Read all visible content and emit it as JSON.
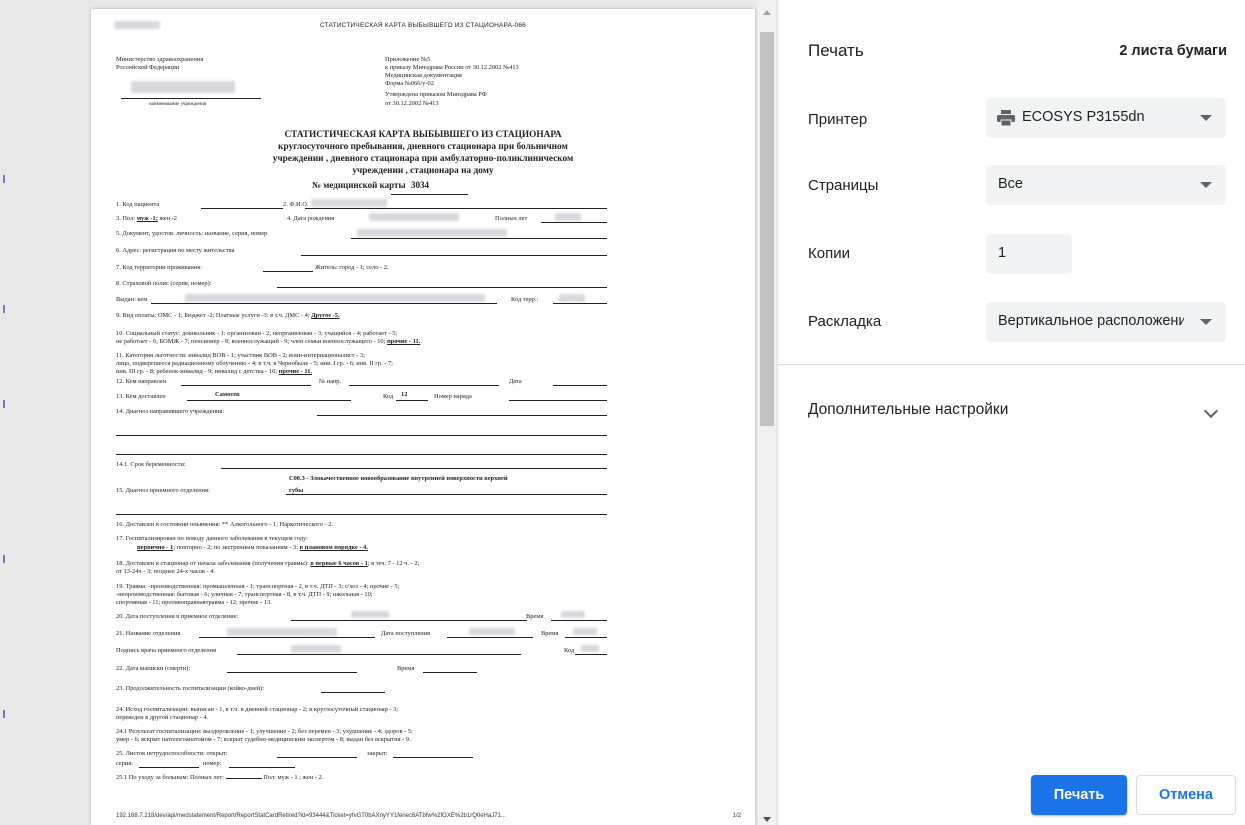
{
  "preview": {
    "header_title": "СТАТИСТИЧЕСКАЯ КАРТА ВЫБЫВШЕГО ИЗ СТАЦИОНАРА-066",
    "left_header_1": "Министерство здравоохранения",
    "left_header_2": "Российской Федерации",
    "institution_caption": "наименование учреждения",
    "right_header": [
      "Приложение №5",
      "к приказу Минздрава России от 30.12.2002 №413",
      "Медицинская документация",
      "Форма №066/у-02",
      "Утверждена приказом Минздрава РФ",
      "от 30.12.2002 №413"
    ],
    "title_lines": [
      "СТАТИСТИЧЕСКАЯ КАРТА ВЫБЫВШЕГО ИЗ СТАЦИОНАРА",
      "круглосуточного пребывания, дневного стационара при больничном",
      "учреждении , дневного стационара при амбулаторно-поликлиническом",
      "учреждении , стационара на дому"
    ],
    "card_no_label": "№ медицинской карты",
    "card_no": "3034",
    "fields": {
      "f1": "1. Код пациента",
      "f2": "2. Ф.И.О.",
      "f3a": "3. Пол:",
      "f3b": "муж -1;",
      "f3c": " жен -2",
      "f4": "4. Дата рождения",
      "f4b": "Полных лет",
      "f5": "5. Документ, удостов. личность: название, серия, номер",
      "f6": "6. Адрес: регистрация по месту жительства",
      "f7": "7. Код территории проживания:",
      "f7b": "Житель: город - 1; село - 2.",
      "f8": "8. Страховой полис (серия, номер):",
      "f8b": "Выдан: кем",
      "f8c": "Код терр.:",
      "f9a": "9. Вид оплаты: ОМС - 1; Бюджет -2; Платные услуги -3: в т.ч. ДМС - 4;",
      "f9b": "Другое -5.",
      "f10a": "10. Социальный статус: дошкольник - 1: организован - 2; неорганизован - 3; учащийся - 4; работает - 5;",
      "f10b": "не работает - 6; БОМЖ - 7; пенсионер - 8; военнослужащий - 9; член семьи военнослужащего - 10;",
      "f10c": "прочие - 11.",
      "f11a": "11. Категория льготности: инвалид ВОВ - 1; участник ВОВ - 2; воин-интернационалист - 3;",
      "f11b": "лицо, подвергшееся радиационному облучению - 4; в т.ч. в Чернобыле - 5; инв. I гр. - 6; инв. II гр. - 7;",
      "f11c": "инв. III гр. - 8; ребенок-инвалид - 9; инвалид с детства - 10;",
      "f11d": "прочие - 11.",
      "f12": "12. Кем направлен",
      "f12b": "№ напр.",
      "f12c": "Дата",
      "f13": "13. Кем доставлен",
      "f13v": "Самотек",
      "f13b": "Код",
      "f13bv": "12",
      "f13c": "Номер наряда",
      "f14": "14. Диагноз направившего учреждения:",
      "f141": "14.1. Срок беременности:",
      "f15v1": "C00.3 - Злокачественное новообразование внутренней поверхности верхней",
      "f15v2": "губы",
      "f15": "15. Диагноз приемного отделения:",
      "f16": "16. Доставлен в состоянии опьянения: ** Алкогольного - 1; Наркотического - 2.",
      "f17": "17. Госпитализирован по поводу данного заболевания в текущем году:",
      "f17b": "первично - 1",
      "f17c": "; повторно - 2; по экстренным показаниям - 3;",
      "f17d": "в плановом порядке - 4.",
      "f18a": "18. Доставлен в стационар от начала заболевания (получения травмы):",
      "f18b": "в первые 6 часов - 1",
      "f18c": "; в теч. 7 - 12 ч. - 2;",
      "f18d": "от 13-24ч - 3; позднее 24-х часов - 4.",
      "f19a": "19. Травма: -производственная: промышленная - 1; транспортная - 2, в т.ч. ДТП - 3; с/хоз - 4; прочие - 5;",
      "f19b": "-непроизводственная: бытовая - 6; уличная - 7; транспортная - 8, в т.ч. ДТП - 9; школьная - 10;",
      "f19c": "спортивная - 11; противоправнаятравма - 12; прочие - 13.",
      "f20": "20. Дата поступления в приемное отделение:",
      "f20b": "Время",
      "f21": "21. Название отделения",
      "f21b": "Дата поступления",
      "f21c": "Время",
      "f21d": "Подпись врача приемного отделения",
      "f21e": "Код",
      "f22": "22. Дата выписки (смерти):",
      "f22b": "Время",
      "f23": "23. Продолжительность госпитализации (койко-дней):",
      "f24a": "24. Исход госпитализации: выписан - 1, в т.ч. в дневной стационар - 2; в круглосуточный стационар - 3;",
      "f24b": "переведен в другой стационар - 4.",
      "f241a": "24.1 Результат госпитализации: выздоровление - 1; улучшение - 2; без перемен - 3; ухудшение - 4; здоров - 5;",
      "f241b": "умер - 6; вскрыт патологоанатомом - 7; вскрыт судебно-медицинским экспертом - 8; выдан без вскрытия - 9.",
      "f25": "25. Листок нетрудоспособности: открыт:",
      "f25b": "закрыт:",
      "f25c": "серия:",
      "f25d": "номер:",
      "f251": "25.1 По уходу за больным: Полных лет:",
      "f251b": "Пол:  муж - 1 ; жен - 2."
    },
    "footer_url": "192.168.7.218/dev/api/medstatement/Report/ReportStatCardRetired?id=93444&Ticket=yfvGT0bAXnyYY1feriec6ATbfw%2fGXE%2b1rQ0eHaJ71...",
    "footer_page": "1/2"
  },
  "panel": {
    "title": "Печать",
    "sheets": "2 листа бумаги",
    "printer_label": "Принтер",
    "printer_value": "ECOSYS P3155dn",
    "pages_label": "Страницы",
    "pages_value": "Все",
    "copies_label": "Копии",
    "copies_value": "1",
    "layout_label": "Раскладка",
    "layout_value": "Вертикальное расположение",
    "more_settings": "Дополнительные настройки",
    "print_button": "Печать",
    "cancel_button": "Отмена"
  },
  "icons": {
    "printer": "printer-icon",
    "dropdown": "chevron-down-icon"
  },
  "colors": {
    "accent": "#1a73e8",
    "field_bg": "#f1f3f4",
    "preview_bg": "#e9e9e9"
  }
}
